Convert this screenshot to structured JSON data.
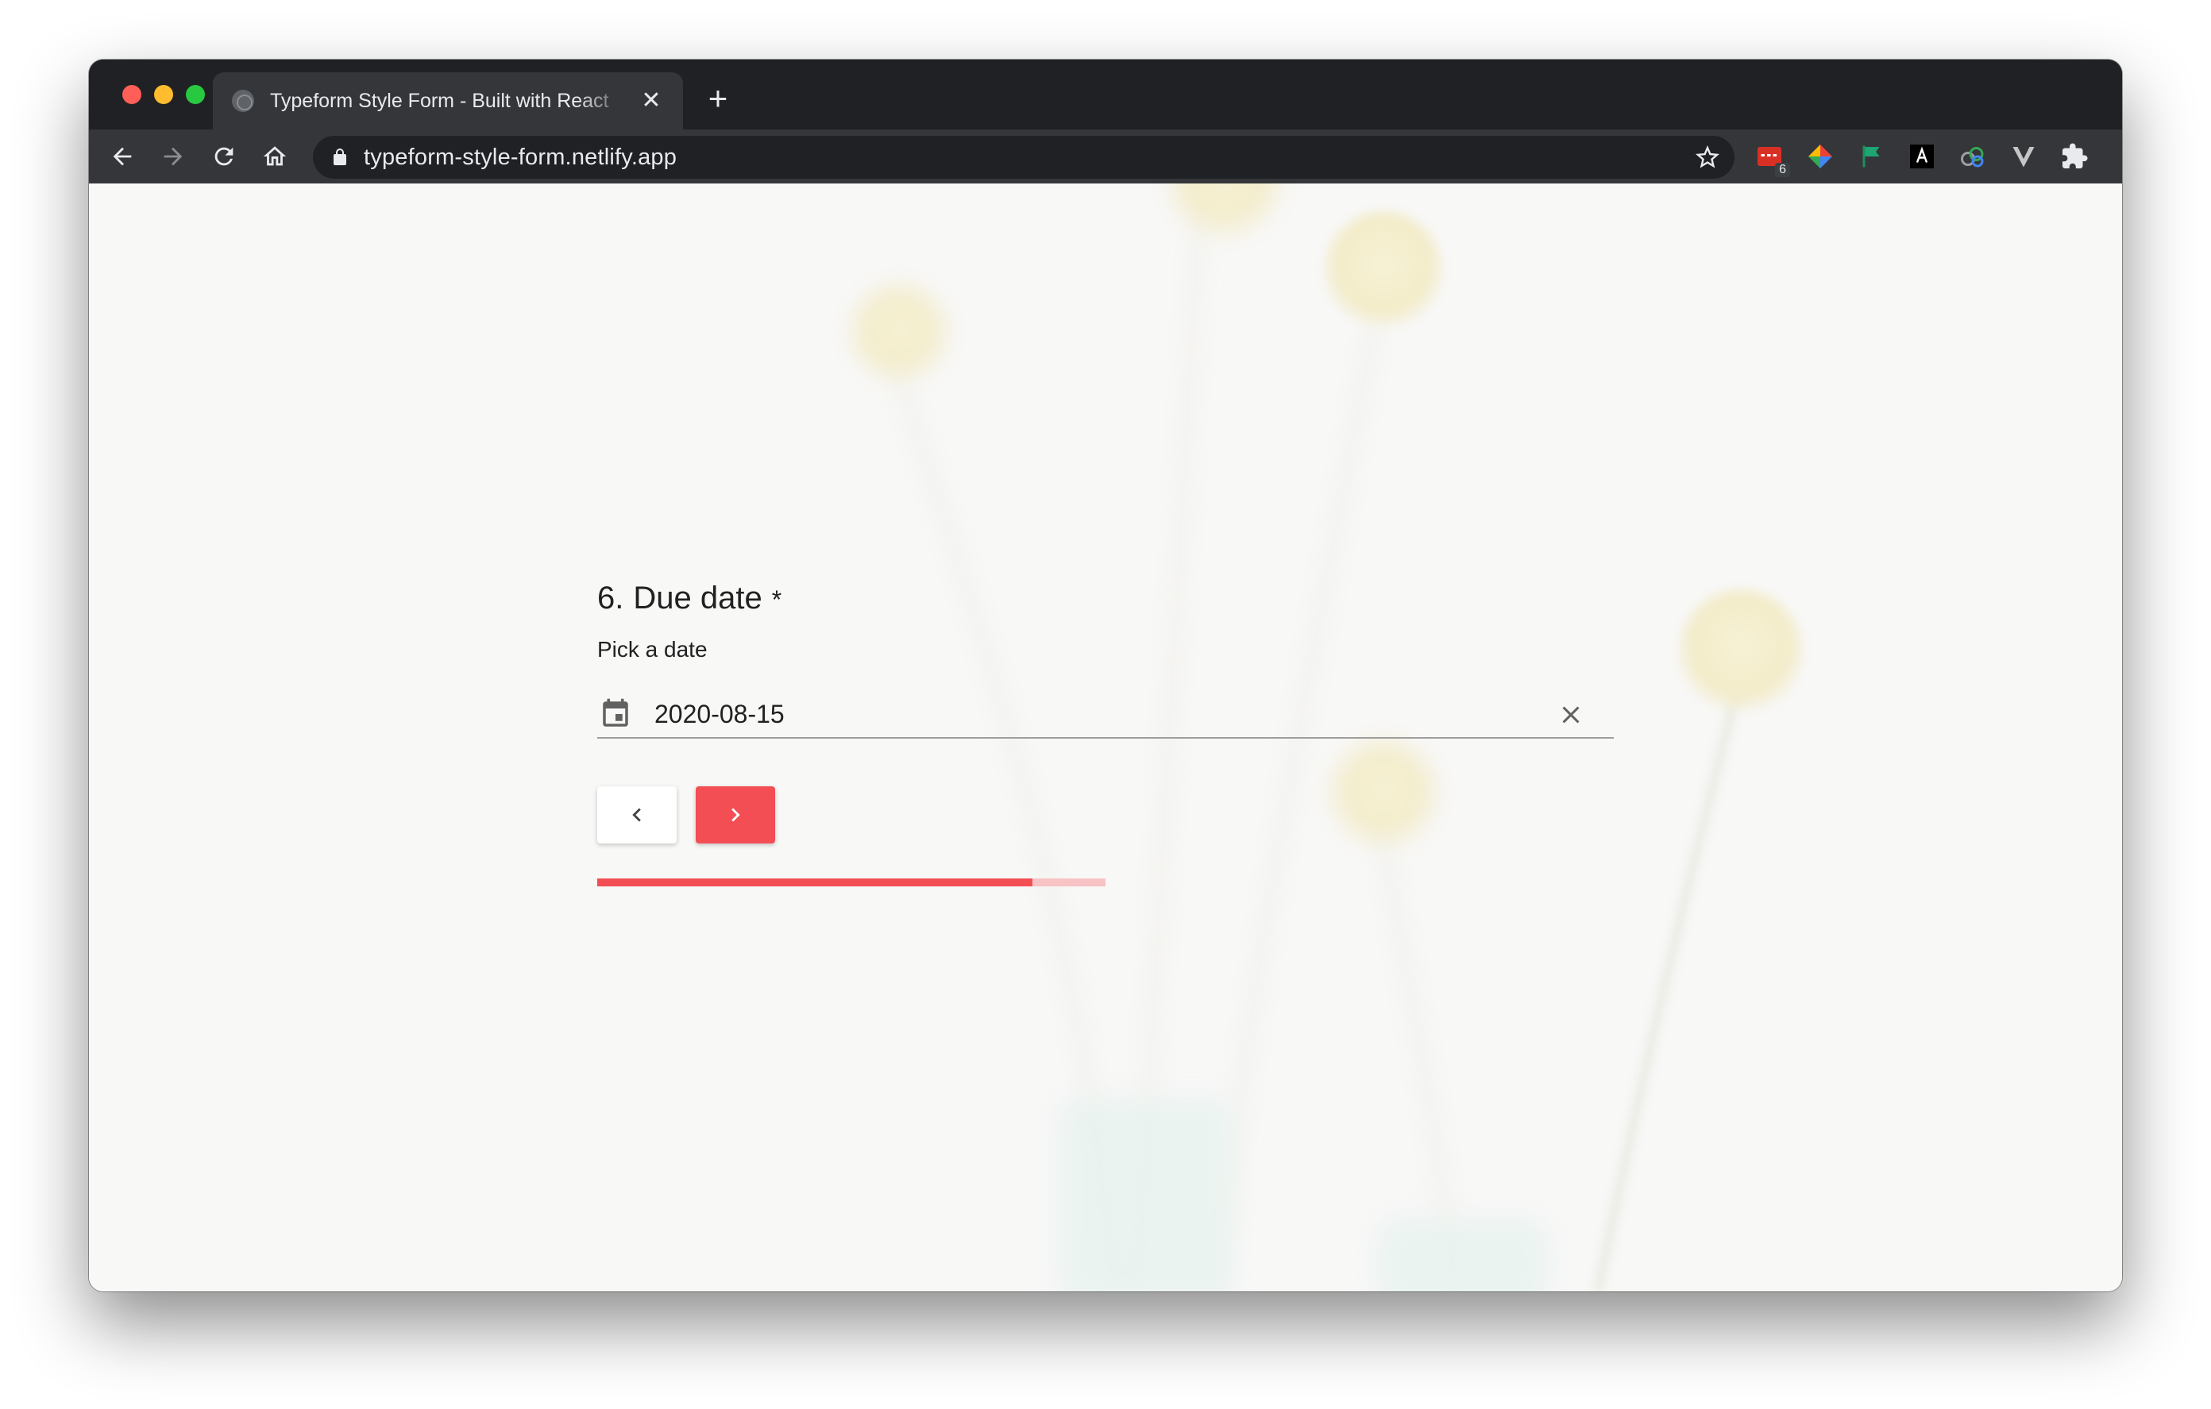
{
  "browser": {
    "tab": {
      "title": "Typeform Style Form - Built with React",
      "close_glyph": "✕"
    },
    "new_tab_glyph": "+",
    "address_bar": {
      "url": "typeform-style-form.netlify.app"
    },
    "extensions": [
      {
        "name": "calendar-extension-icon",
        "badge": "6"
      },
      {
        "name": "color-wheel-extension-icon"
      },
      {
        "name": "flag-extension-icon"
      },
      {
        "name": "dark-a-extension-icon"
      },
      {
        "name": "rings-extension-icon"
      },
      {
        "name": "v-extension-icon"
      },
      {
        "name": "puzzle-icon"
      }
    ]
  },
  "form": {
    "question_number": "6.",
    "question_title": "Due date",
    "required_marker": "*",
    "description": "Pick a date",
    "date_value": "2020-08-15",
    "progress_fraction": 0.857,
    "accent_color": "#f44e55"
  }
}
